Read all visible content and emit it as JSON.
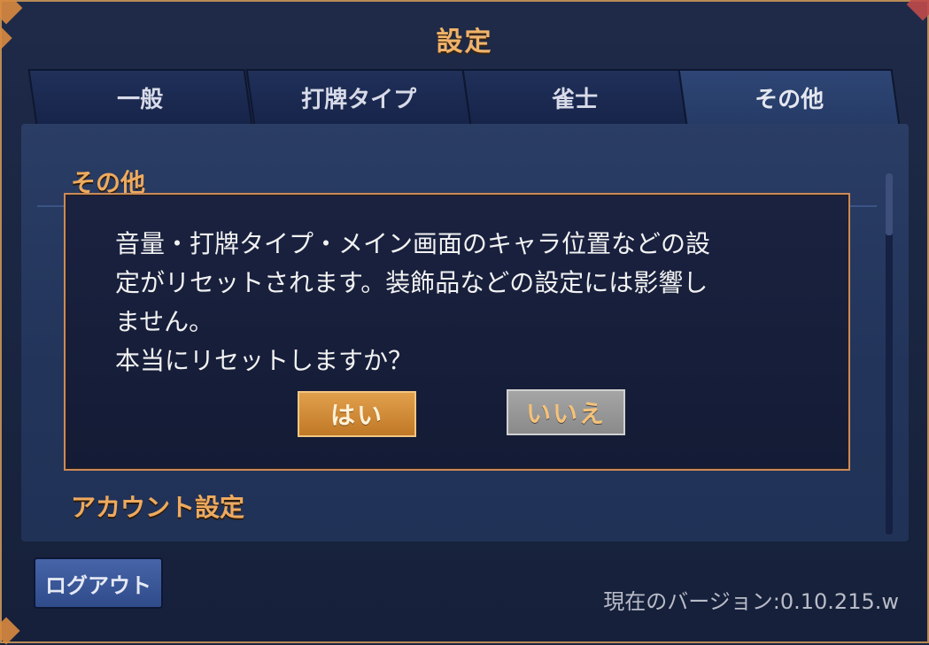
{
  "window": {
    "title": "設定"
  },
  "tabs": [
    {
      "label": "一般"
    },
    {
      "label": "打牌タイプ"
    },
    {
      "label": "雀士"
    },
    {
      "label": "その他"
    }
  ],
  "sections": {
    "other": "その他",
    "account": "アカウント設定"
  },
  "dialog": {
    "lines": [
      "音量・打牌タイプ・メイン画面のキャラ位置などの設",
      "定がリセットされます。装飾品などの設定には影響し",
      "ません。",
      "本当にリセットしますか？"
    ],
    "yes_label": "はい",
    "no_label": "いいえ"
  },
  "footer": {
    "logout_label": "ログアウト",
    "version_text": "現在のバージョン:0.10.215.w"
  },
  "colors": {
    "accent": "#eeaa5e",
    "panel": "#2a3d65",
    "background": "#1b2540"
  }
}
